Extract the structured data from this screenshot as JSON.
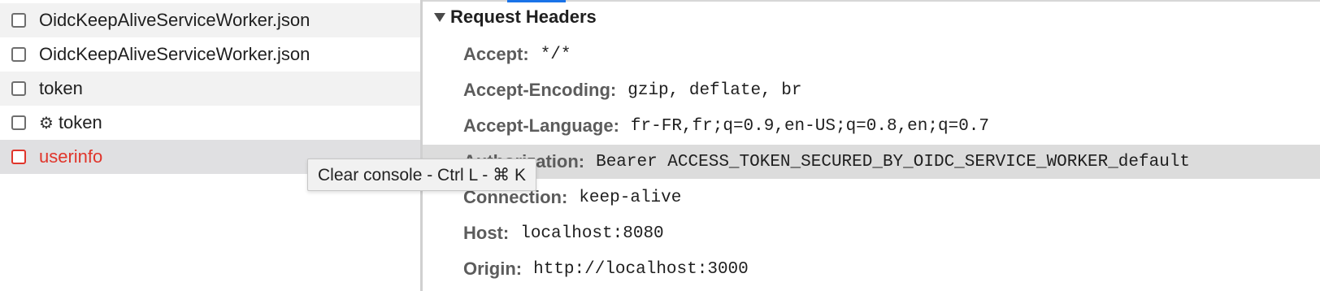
{
  "request_list": {
    "items": [
      {
        "name": "OidcKeepAliveServiceWorker.json",
        "status": "normal"
      },
      {
        "name": "OidcKeepAliveServiceWorker.json",
        "status": "normal"
      },
      {
        "name": "token",
        "status": "normal"
      },
      {
        "name": "token",
        "status": "service-worker",
        "icon": "gear-icon"
      },
      {
        "name": "userinfo",
        "status": "error"
      }
    ],
    "colors": {
      "error": "#e0352b",
      "selected_row": "#e0e0e2"
    }
  },
  "headers_panel": {
    "section_title": "Request Headers",
    "headers": [
      {
        "name": "Accept:",
        "value": "*/*"
      },
      {
        "name": "Accept-Encoding:",
        "value": "gzip, deflate, br"
      },
      {
        "name": "Accept-Language:",
        "value": "fr-FR,fr;q=0.9,en-US;q=0.8,en;q=0.7"
      },
      {
        "name": "Authorization:",
        "value": "Bearer ACCESS_TOKEN_SECURED_BY_OIDC_SERVICE_WORKER_default"
      },
      {
        "name": "Connection:",
        "value": "keep-alive"
      },
      {
        "name": "Host:",
        "value": "localhost:8080"
      },
      {
        "name": "Origin:",
        "value": "http://localhost:3000"
      }
    ],
    "colors": {
      "tab_indicator": "#1a73e8",
      "highlight_row": "#dcdcdc"
    }
  },
  "tooltip": {
    "text": "Clear console - Ctrl L - ⌘ K"
  }
}
